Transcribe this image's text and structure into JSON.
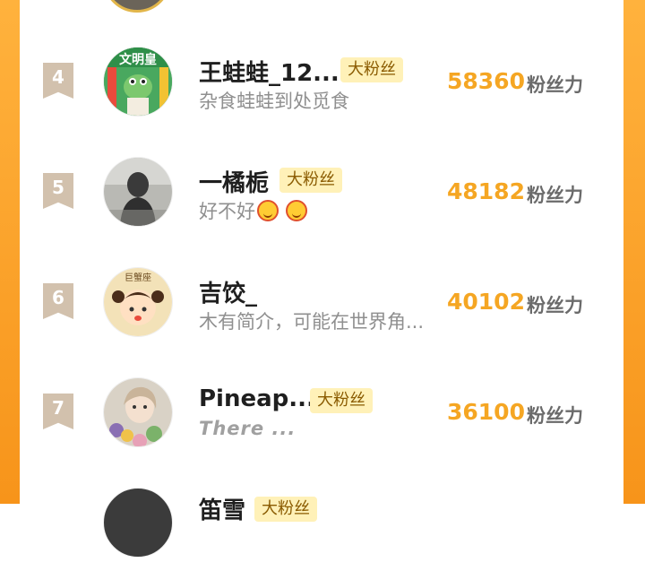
{
  "ranking": {
    "unit_label": "粉丝力",
    "items": [
      {
        "rank": "4",
        "name": "王蛙蛙_12...",
        "badge": "大粉丝",
        "desc": "杂食蛙蛙到处觅食",
        "score": "58360"
      },
      {
        "rank": "5",
        "name": "一橘栀",
        "badge": "大粉丝",
        "desc": "好不好",
        "score": "48182"
      },
      {
        "rank": "6",
        "name": "吉饺_",
        "badge": "",
        "desc": "木有简介，可能在世界角...",
        "score": "40102"
      },
      {
        "rank": "7",
        "name": "Pineap...",
        "badge": "大粉丝",
        "desc": "There ...",
        "score": "36100"
      },
      {
        "rank": "",
        "name": "笛雪",
        "badge": "大粉丝",
        "desc": "",
        "score": ""
      }
    ],
    "avatar_texts": {
      "row4": "文明皇",
      "row6": "巨蟹座"
    }
  }
}
